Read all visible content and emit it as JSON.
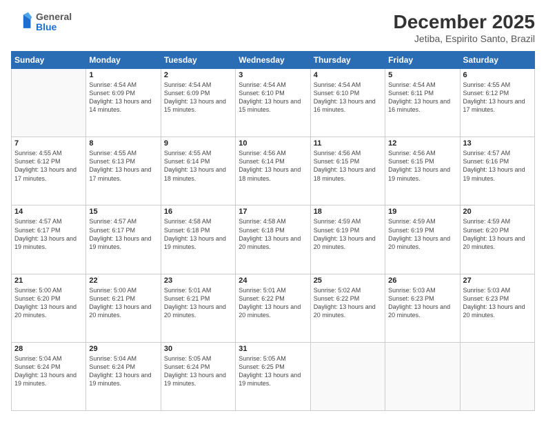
{
  "header": {
    "logo_general": "General",
    "logo_blue": "Blue",
    "month_title": "December 2025",
    "location": "Jetiba, Espirito Santo, Brazil"
  },
  "weekdays": [
    "Sunday",
    "Monday",
    "Tuesday",
    "Wednesday",
    "Thursday",
    "Friday",
    "Saturday"
  ],
  "weeks": [
    [
      {
        "day": "",
        "sunrise": "",
        "sunset": "",
        "daylight": ""
      },
      {
        "day": "1",
        "sunrise": "Sunrise: 4:54 AM",
        "sunset": "Sunset: 6:09 PM",
        "daylight": "Daylight: 13 hours and 14 minutes."
      },
      {
        "day": "2",
        "sunrise": "Sunrise: 4:54 AM",
        "sunset": "Sunset: 6:09 PM",
        "daylight": "Daylight: 13 hours and 15 minutes."
      },
      {
        "day": "3",
        "sunrise": "Sunrise: 4:54 AM",
        "sunset": "Sunset: 6:10 PM",
        "daylight": "Daylight: 13 hours and 15 minutes."
      },
      {
        "day": "4",
        "sunrise": "Sunrise: 4:54 AM",
        "sunset": "Sunset: 6:10 PM",
        "daylight": "Daylight: 13 hours and 16 minutes."
      },
      {
        "day": "5",
        "sunrise": "Sunrise: 4:54 AM",
        "sunset": "Sunset: 6:11 PM",
        "daylight": "Daylight: 13 hours and 16 minutes."
      },
      {
        "day": "6",
        "sunrise": "Sunrise: 4:55 AM",
        "sunset": "Sunset: 6:12 PM",
        "daylight": "Daylight: 13 hours and 17 minutes."
      }
    ],
    [
      {
        "day": "7",
        "sunrise": "Sunrise: 4:55 AM",
        "sunset": "Sunset: 6:12 PM",
        "daylight": "Daylight: 13 hours and 17 minutes."
      },
      {
        "day": "8",
        "sunrise": "Sunrise: 4:55 AM",
        "sunset": "Sunset: 6:13 PM",
        "daylight": "Daylight: 13 hours and 17 minutes."
      },
      {
        "day": "9",
        "sunrise": "Sunrise: 4:55 AM",
        "sunset": "Sunset: 6:14 PM",
        "daylight": "Daylight: 13 hours and 18 minutes."
      },
      {
        "day": "10",
        "sunrise": "Sunrise: 4:56 AM",
        "sunset": "Sunset: 6:14 PM",
        "daylight": "Daylight: 13 hours and 18 minutes."
      },
      {
        "day": "11",
        "sunrise": "Sunrise: 4:56 AM",
        "sunset": "Sunset: 6:15 PM",
        "daylight": "Daylight: 13 hours and 18 minutes."
      },
      {
        "day": "12",
        "sunrise": "Sunrise: 4:56 AM",
        "sunset": "Sunset: 6:15 PM",
        "daylight": "Daylight: 13 hours and 19 minutes."
      },
      {
        "day": "13",
        "sunrise": "Sunrise: 4:57 AM",
        "sunset": "Sunset: 6:16 PM",
        "daylight": "Daylight: 13 hours and 19 minutes."
      }
    ],
    [
      {
        "day": "14",
        "sunrise": "Sunrise: 4:57 AM",
        "sunset": "Sunset: 6:17 PM",
        "daylight": "Daylight: 13 hours and 19 minutes."
      },
      {
        "day": "15",
        "sunrise": "Sunrise: 4:57 AM",
        "sunset": "Sunset: 6:17 PM",
        "daylight": "Daylight: 13 hours and 19 minutes."
      },
      {
        "day": "16",
        "sunrise": "Sunrise: 4:58 AM",
        "sunset": "Sunset: 6:18 PM",
        "daylight": "Daylight: 13 hours and 19 minutes."
      },
      {
        "day": "17",
        "sunrise": "Sunrise: 4:58 AM",
        "sunset": "Sunset: 6:18 PM",
        "daylight": "Daylight: 13 hours and 20 minutes."
      },
      {
        "day": "18",
        "sunrise": "Sunrise: 4:59 AM",
        "sunset": "Sunset: 6:19 PM",
        "daylight": "Daylight: 13 hours and 20 minutes."
      },
      {
        "day": "19",
        "sunrise": "Sunrise: 4:59 AM",
        "sunset": "Sunset: 6:19 PM",
        "daylight": "Daylight: 13 hours and 20 minutes."
      },
      {
        "day": "20",
        "sunrise": "Sunrise: 4:59 AM",
        "sunset": "Sunset: 6:20 PM",
        "daylight": "Daylight: 13 hours and 20 minutes."
      }
    ],
    [
      {
        "day": "21",
        "sunrise": "Sunrise: 5:00 AM",
        "sunset": "Sunset: 6:20 PM",
        "daylight": "Daylight: 13 hours and 20 minutes."
      },
      {
        "day": "22",
        "sunrise": "Sunrise: 5:00 AM",
        "sunset": "Sunset: 6:21 PM",
        "daylight": "Daylight: 13 hours and 20 minutes."
      },
      {
        "day": "23",
        "sunrise": "Sunrise: 5:01 AM",
        "sunset": "Sunset: 6:21 PM",
        "daylight": "Daylight: 13 hours and 20 minutes."
      },
      {
        "day": "24",
        "sunrise": "Sunrise: 5:01 AM",
        "sunset": "Sunset: 6:22 PM",
        "daylight": "Daylight: 13 hours and 20 minutes."
      },
      {
        "day": "25",
        "sunrise": "Sunrise: 5:02 AM",
        "sunset": "Sunset: 6:22 PM",
        "daylight": "Daylight: 13 hours and 20 minutes."
      },
      {
        "day": "26",
        "sunrise": "Sunrise: 5:03 AM",
        "sunset": "Sunset: 6:23 PM",
        "daylight": "Daylight: 13 hours and 20 minutes."
      },
      {
        "day": "27",
        "sunrise": "Sunrise: 5:03 AM",
        "sunset": "Sunset: 6:23 PM",
        "daylight": "Daylight: 13 hours and 20 minutes."
      }
    ],
    [
      {
        "day": "28",
        "sunrise": "Sunrise: 5:04 AM",
        "sunset": "Sunset: 6:24 PM",
        "daylight": "Daylight: 13 hours and 19 minutes."
      },
      {
        "day": "29",
        "sunrise": "Sunrise: 5:04 AM",
        "sunset": "Sunset: 6:24 PM",
        "daylight": "Daylight: 13 hours and 19 minutes."
      },
      {
        "day": "30",
        "sunrise": "Sunrise: 5:05 AM",
        "sunset": "Sunset: 6:24 PM",
        "daylight": "Daylight: 13 hours and 19 minutes."
      },
      {
        "day": "31",
        "sunrise": "Sunrise: 5:05 AM",
        "sunset": "Sunset: 6:25 PM",
        "daylight": "Daylight: 13 hours and 19 minutes."
      },
      {
        "day": "",
        "sunrise": "",
        "sunset": "",
        "daylight": ""
      },
      {
        "day": "",
        "sunrise": "",
        "sunset": "",
        "daylight": ""
      },
      {
        "day": "",
        "sunrise": "",
        "sunset": "",
        "daylight": ""
      }
    ]
  ]
}
